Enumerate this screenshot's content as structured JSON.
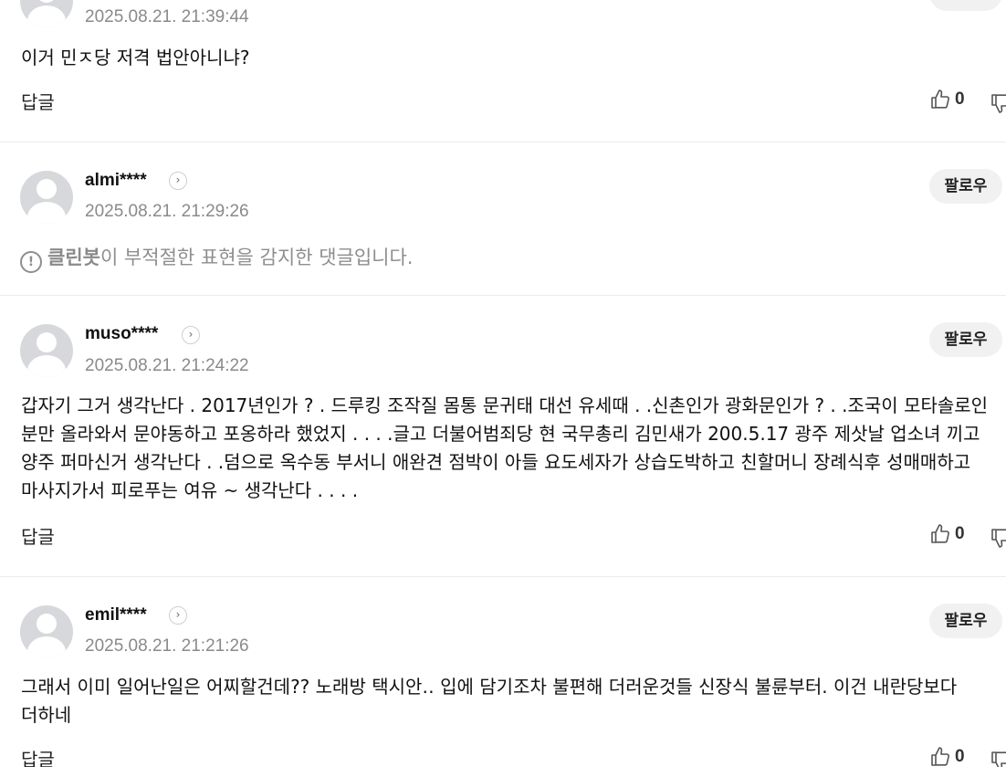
{
  "comments": [
    {
      "username": "",
      "timestamp": "2025.08.21. 21:39:44",
      "text": "이거 민ㅈ당 저격 법안아니냐?",
      "reply_label": "답글",
      "likes": "0"
    },
    {
      "username": "almi****",
      "timestamp": "2025.08.21. 21:29:26",
      "follow_label": "팔로우",
      "cleanbot_name": "클린봇",
      "cleanbot_text": "이 부적절한 표현을 감지한 댓글입니다."
    },
    {
      "username": "muso****",
      "timestamp": "2025.08.21. 21:24:22",
      "follow_label": "팔로우",
      "text_lines": [
        "갑자기 그거 생각난다 . 2017년인가 ? . 드루킹 조작질 몸통 문귀태 대선 유세때 . .신촌인가 광화문인가 ? . .조국이 모타솔로인",
        "분만 올라와서 문야동하고 포옹하라 했었지 . . . .글고 더불어범죄당 현 국무총리 김민새가 200.5.17 광주 제삿날 업소녀 끼고",
        "양주 퍼마신거 생각난다 . .덤으로 옥수동 부서니 애완견 점박이 아들 요도세자가 상습도박하고 친할머니 장례식후 성매매하고",
        "마사지가서 피로푸는 여유 ~ 생각난다 . . . ."
      ],
      "reply_label": "답글",
      "likes": "0"
    },
    {
      "username": "emil****",
      "timestamp": "2025.08.21. 21:21:26",
      "follow_label": "팔로우",
      "text_lines": [
        "그래서 이미 일어난일은 어찌할건데?? 노래방 택시안‥ 입에 담기조차 불편해 더러운것들 신장식 불륜부터. 이건 내란당보다",
        "더하네"
      ],
      "reply_label": "답글",
      "likes": "0"
    }
  ]
}
